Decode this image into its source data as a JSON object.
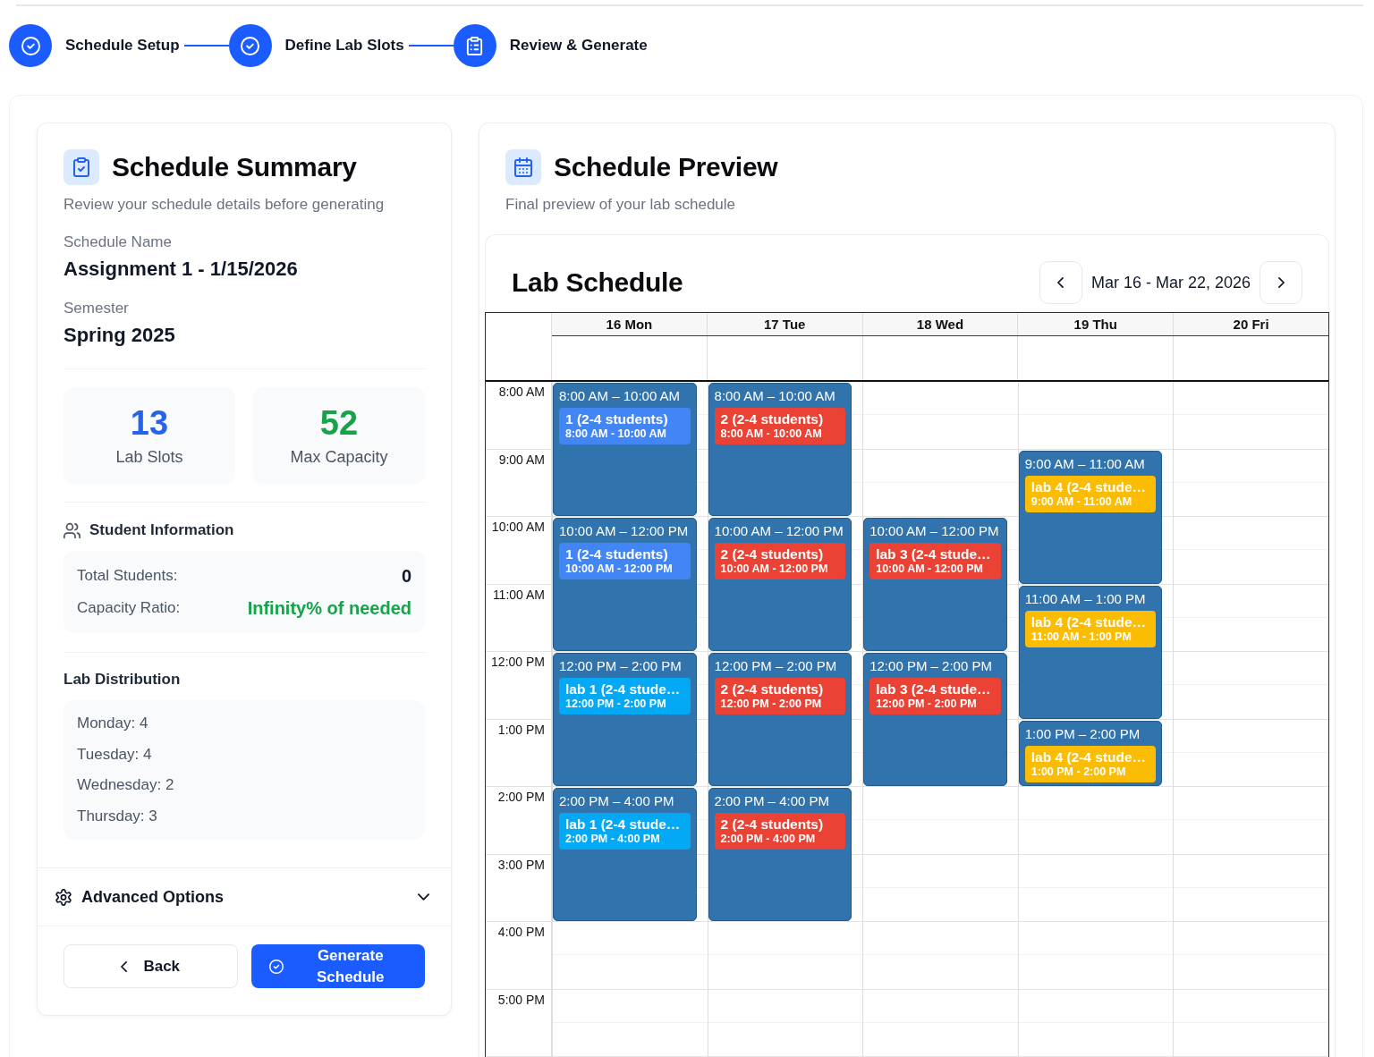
{
  "steps": [
    {
      "label": "Schedule Setup",
      "completed": true
    },
    {
      "label": "Define Lab Slots",
      "completed": true
    },
    {
      "label": "Review & Generate",
      "completed": false
    }
  ],
  "summary": {
    "title": "Schedule Summary",
    "subtitle": "Review your schedule details before generating",
    "fields": [
      {
        "label": "Schedule Name",
        "value": "Assignment 1 - 1/15/2026"
      },
      {
        "label": "Semester",
        "value": "Spring 2025"
      }
    ],
    "stats": [
      {
        "value": "13",
        "label": "Lab Slots",
        "color": "#2563eb"
      },
      {
        "value": "52",
        "label": "Max Capacity",
        "color": "#16a34a"
      }
    ],
    "student_info": {
      "title": "Student Information",
      "rows": [
        {
          "label": "Total Students:",
          "value": "0",
          "color": "#111827"
        },
        {
          "label": "Capacity Ratio:",
          "value": "Infinity% of needed",
          "color": "#16a34a"
        }
      ]
    },
    "lab_distribution": {
      "title": "Lab Distribution",
      "items": [
        "Monday: 4",
        "Tuesday: 4",
        "Wednesday: 2",
        "Thursday: 3"
      ]
    },
    "advanced_options": {
      "label": "Advanced Options",
      "expanded": false
    },
    "buttons": [
      {
        "label": "Back",
        "kind": "secondary"
      },
      {
        "label": "Generate Schedule",
        "kind": "primary"
      }
    ]
  },
  "preview": {
    "title": "Schedule Preview",
    "subtitle": "Final preview of your lab schedule",
    "calendar": {
      "title": "Lab Schedule",
      "range": "Mar 16 - Mar 22, 2026",
      "hours": [
        "8:00 AM",
        "9:00 AM",
        "10:00 AM",
        "11:00 AM",
        "12:00 PM",
        "1:00 PM",
        "2:00 PM",
        "3:00 PM",
        "4:00 PM",
        "5:00 PM"
      ],
      "days": [
        {
          "label": "16 Mon",
          "events": [
            {
              "time": "8:00 AM – 10:00 AM",
              "title": "1 (2-4 students)",
              "detail": "8:00 AM - 10:00 AM",
              "color": "#4285f4"
            },
            {
              "time": "10:00 AM – 12:00 PM",
              "title": "1 (2-4 students)",
              "detail": "10:00 AM - 12:00 PM",
              "color": "#4285f4"
            },
            {
              "time": "12:00 PM – 2:00 PM",
              "title": "lab 1 (2-4 stude…",
              "detail": "12:00 PM - 2:00 PM",
              "color": "#03a9f4"
            },
            {
              "time": "2:00 PM – 4:00 PM",
              "title": "lab 1 (2-4 stude…",
              "detail": "2:00 PM - 4:00 PM",
              "color": "#03a9f4"
            }
          ]
        },
        {
          "label": "17 Tue",
          "events": [
            {
              "time": "8:00 AM – 10:00 AM",
              "title": "2 (2-4 students)",
              "detail": "8:00 AM - 10:00 AM",
              "color": "#ea4335"
            },
            {
              "time": "10:00 AM – 12:00 PM",
              "title": "2 (2-4 students)",
              "detail": "10:00 AM - 12:00 PM",
              "color": "#ea4335"
            },
            {
              "time": "12:00 PM – 2:00 PM",
              "title": "2 (2-4 students)",
              "detail": "12:00 PM - 2:00 PM",
              "color": "#ea4335"
            },
            {
              "time": "2:00 PM – 4:00 PM",
              "title": "2 (2-4 students)",
              "detail": "2:00 PM - 4:00 PM",
              "color": "#ea4335"
            }
          ]
        },
        {
          "label": "18 Wed",
          "events": [
            {
              "time": "10:00 AM – 12:00 PM",
              "title": "lab 3 (2-4 stude…",
              "detail": "10:00 AM - 12:00 PM",
              "color": "#ea4335"
            },
            {
              "time": "12:00 PM – 2:00 PM",
              "title": "lab 3 (2-4 stude…",
              "detail": "12:00 PM - 2:00 PM",
              "color": "#ea4335"
            }
          ]
        },
        {
          "label": "19 Thu",
          "events": [
            {
              "time": "9:00 AM – 11:00 AM",
              "title": "lab 4 (2-4 stude…",
              "detail": "9:00 AM - 11:00 AM",
              "color": "#fbbc04"
            },
            {
              "time": "11:00 AM – 1:00 PM",
              "title": "lab 4 (2-4 stude…",
              "detail": "11:00 AM - 1:00 PM",
              "color": "#fbbc04"
            },
            {
              "time": "1:00 PM – 2:00 PM",
              "title": "lab 4 (2-4 stude…",
              "detail": "1:00 PM - 2:00 PM",
              "color": "#fbbc04"
            }
          ]
        },
        {
          "label": "20 Fri"
        }
      ]
    }
  }
}
